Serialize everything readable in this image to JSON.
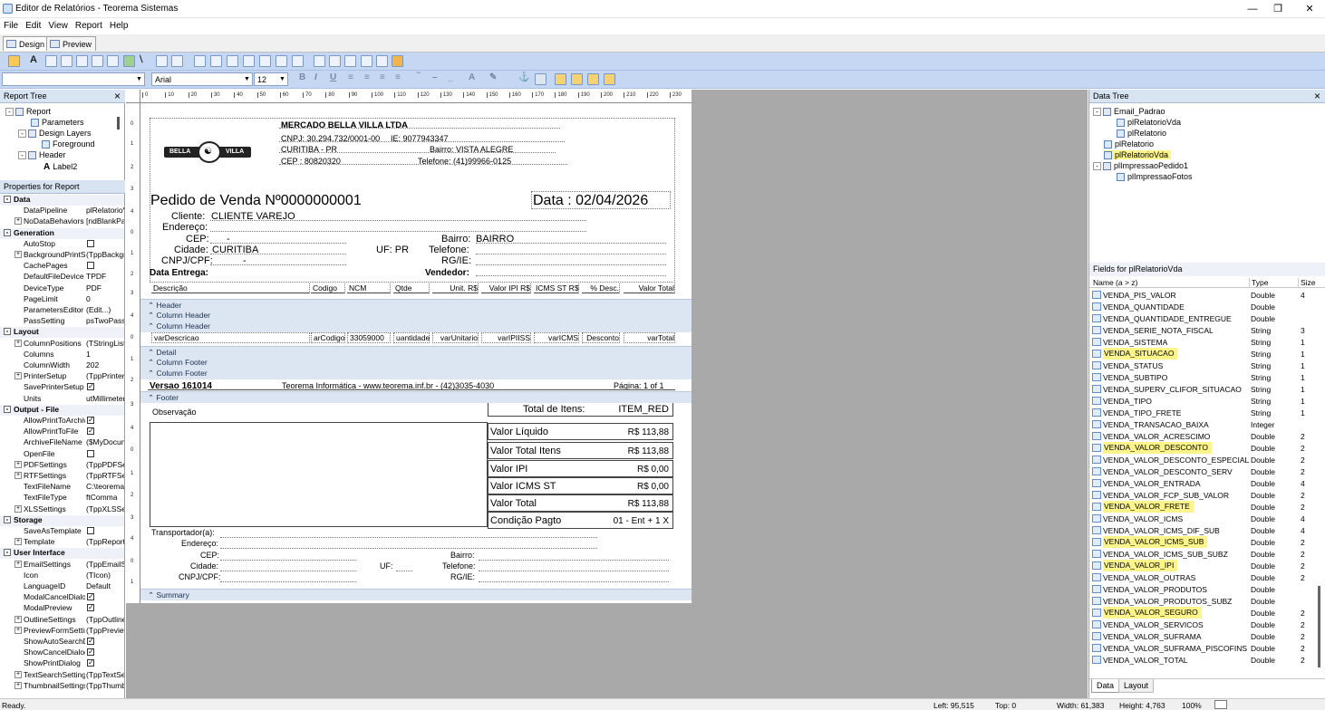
{
  "window": {
    "title": "Editor de Relatórios - Teorema Sistemas"
  },
  "menu": [
    "File",
    "Edit",
    "View",
    "Report",
    "Help"
  ],
  "tabs": {
    "design": "Design",
    "preview": "Preview"
  },
  "format": {
    "font": "Arial",
    "size": "12"
  },
  "report_tree": {
    "title": "Report Tree",
    "items": [
      "Report",
      "Parameters",
      "Design Layers",
      "Foreground",
      "Header",
      "Label2"
    ]
  },
  "properties": {
    "title": "Properties for Report",
    "sections": [
      {
        "name": "Data",
        "rows": [
          [
            "DataPipeline",
            "plRelatorioV"
          ],
          [
            "NoDataBehaviors",
            "[ndBlankPa"
          ]
        ]
      },
      {
        "name": "Generation",
        "rows": [
          [
            "AutoStop",
            ""
          ],
          [
            "BackgroundPrintSe",
            "(TppBackgr"
          ],
          [
            "CachePages",
            ""
          ],
          [
            "DefaultFileDevice",
            "TPDF"
          ],
          [
            "DeviceType",
            "PDF"
          ],
          [
            "PageLimit",
            "0"
          ],
          [
            "ParametersEditor",
            "(Edit...)"
          ],
          [
            "PassSetting",
            "psTwoPass"
          ]
        ]
      },
      {
        "name": "Layout",
        "rows": [
          [
            "ColumnPositions",
            "(TStringList"
          ],
          [
            "Columns",
            "1"
          ],
          [
            "ColumnWidth",
            "202"
          ],
          [
            "PrinterSetup",
            "(TppPrinter"
          ],
          [
            "SavePrinterSetup",
            ""
          ],
          [
            "Units",
            "utMillimeter"
          ]
        ]
      },
      {
        "name": "Output - File",
        "rows": [
          [
            "AllowPrintToArchiv",
            ""
          ],
          [
            "AllowPrintToFile",
            ""
          ],
          [
            "ArchiveFileName",
            "($MyDocum"
          ],
          [
            "OpenFile",
            ""
          ],
          [
            "PDFSettings",
            "(TppPDFSet"
          ],
          [
            "RTFSettings",
            "(TppRTFSet"
          ],
          [
            "TextFileName",
            "C:\\teorema"
          ],
          [
            "TextFileType",
            "ftComma"
          ],
          [
            "XLSSettings",
            "(TppXLSSet"
          ]
        ]
      },
      {
        "name": "Storage",
        "rows": [
          [
            "SaveAsTemplate",
            ""
          ],
          [
            "Template",
            "(TppReport"
          ]
        ]
      },
      {
        "name": "User Interface",
        "rows": [
          [
            "EmailSettings",
            "(TppEmailSe"
          ],
          [
            "Icon",
            "(TIcon)"
          ],
          [
            "LanguageID",
            "Default"
          ],
          [
            "ModalCancelDialog",
            ""
          ],
          [
            "ModalPreview",
            ""
          ],
          [
            "OutlineSettings",
            "(TppOutline"
          ],
          [
            "PreviewFormSettin",
            "(TppPreview"
          ],
          [
            "ShowAutoSearchD",
            ""
          ],
          [
            "ShowCancelDialog",
            ""
          ],
          [
            "ShowPrintDialog",
            ""
          ],
          [
            "TextSearchSetting",
            "(TppTextSe"
          ],
          [
            "ThumbnailSettings",
            "(TppThumb"
          ]
        ]
      }
    ]
  },
  "report": {
    "company": "MERCADO BELLA VILLA LTDA",
    "cnpj": "CNPJ: 30.294.732/0001-00",
    "ie": "IE: 9077943347",
    "city": "CURITIBA - PR",
    "bairro": "Bairro: VISTA ALEGRE",
    "cep": "CEP : 80820320",
    "telefone": "Telefone: (41)99966-0125",
    "logo_left": "BELLA",
    "logo_right": "VILLA",
    "title": "Pedido de Venda Nº0000000001",
    "date": "Data : 02/04/2026",
    "lbl_cliente": "Cliente:",
    "cliente": "CLIENTE VAREJO",
    "lbl_endereco": "Endereço:",
    "lbl_cep": "CEP:",
    "cep_val": "-",
    "lbl_bairro": "Bairro:",
    "bairro_val": "BAIRRO",
    "lbl_cidade": "Cidade:",
    "cidade_val": "CURITIBA",
    "lbl_uf": "UF: PR",
    "lbl_telefone": "Telefone:",
    "lbl_cnpjcpf": "CNPJ/CPF:",
    "cnpjcpf_val": "-",
    "lbl_rgie": "RG/IE:",
    "lbl_data_entrega": "Data Entrega:",
    "lbl_vendedor": "Vendedor:",
    "columns": [
      "Descrição",
      "Codigo",
      "NCM",
      "Qtde",
      "Unit. R$",
      "Valor IPI R$",
      "ICMS ST R$",
      "% Desc.",
      "Valor Total"
    ],
    "detail": [
      "varDescricao",
      "arCodigo",
      "33059000",
      "uantidade",
      "varUnitario",
      "varIPIISS",
      "varICMS",
      "Desconto",
      "varTotal"
    ],
    "bands": {
      "header": "Header",
      "colheader1": "Column Header",
      "colheader2": "Column Header",
      "detail": "Detail",
      "colfooter1": "Column Footer",
      "colfooter2": "Column Footer",
      "footer": "Footer",
      "summary": "Summary"
    },
    "versao": "Versao 161014",
    "teorema": "Teorema Informática  -  www.teorema.inf.br  -  (42)3035-4030",
    "pagina": "Página: 1 of 1",
    "observacao": "Observação",
    "total_itens_lbl": "Total de Itens:",
    "total_itens_val": "ITEM_RED",
    "valor_liquido": "Valor Líquido",
    "valor_liquido_val": "R$ 113,88",
    "valor_total_itens": "Valor Total Itens",
    "valor_total_itens_val": "R$ 113,88",
    "valor_ipi": "Valor IPI",
    "valor_ipi_val": "R$ 0,00",
    "valor_icms_st": "Valor ICMS ST",
    "valor_icms_st_val": "R$ 0,00",
    "valor_total": "Valor Total",
    "valor_total_val": "R$ 113,88",
    "cond_pagto": "Condição Pagto",
    "cond_pagto_val": "01 - Ent + 1 X",
    "transportador": "Transportador(a):",
    "t_endereco": "Endereço:",
    "t_cep": "CEP:",
    "t_bairro": "Bairro:",
    "t_cidade": "Cidade:",
    "t_uf": "UF:",
    "t_telefone": "Telefone:",
    "t_cnpjcpf": "CNPJ/CPF:",
    "t_rgie": "RG/IE:"
  },
  "data_tree": {
    "title": "Data Tree",
    "items": [
      "Email_Padrao",
      "plRelatorioVda",
      "plRelatorio",
      "plRelatorio",
      "plRelatorioVda",
      "plImpressaoPedido1",
      "plImpressaoFotos"
    ]
  },
  "fields": {
    "title": "Fields for plRelatorioVda",
    "headers": [
      "Name (a > z)",
      "Type",
      "Size"
    ],
    "rows": [
      [
        "VENDA_PIS_VALOR",
        "Double",
        "4",
        false
      ],
      [
        "VENDA_QUANTIDADE",
        "Double",
        "",
        false
      ],
      [
        "VENDA_QUANTIDADE_ENTREGUE",
        "Double",
        "",
        false
      ],
      [
        "VENDA_SERIE_NOTA_FISCAL",
        "String",
        "3",
        false
      ],
      [
        "VENDA_SISTEMA",
        "String",
        "1",
        false
      ],
      [
        "VENDA_SITUACAO",
        "String",
        "1",
        true
      ],
      [
        "VENDA_STATUS",
        "String",
        "1",
        false
      ],
      [
        "VENDA_SUBTIPO",
        "String",
        "1",
        false
      ],
      [
        "VENDA_SUPERV_CLIFOR_SITUACAO",
        "String",
        "1",
        false
      ],
      [
        "VENDA_TIPO",
        "String",
        "1",
        false
      ],
      [
        "VENDA_TIPO_FRETE",
        "String",
        "1",
        false
      ],
      [
        "VENDA_TRANSACAO_BAIXA",
        "Integer",
        "",
        false
      ],
      [
        "VENDA_VALOR_ACRESCIMO",
        "Double",
        "2",
        false
      ],
      [
        "VENDA_VALOR_DESCONTO",
        "Double",
        "2",
        true
      ],
      [
        "VENDA_VALOR_DESCONTO_ESPECIAL",
        "Double",
        "2",
        false
      ],
      [
        "VENDA_VALOR_DESCONTO_SERV",
        "Double",
        "2",
        false
      ],
      [
        "VENDA_VALOR_ENTRADA",
        "Double",
        "4",
        false
      ],
      [
        "VENDA_VALOR_FCP_SUB_VALOR",
        "Double",
        "2",
        false
      ],
      [
        "VENDA_VALOR_FRETE",
        "Double",
        "2",
        true
      ],
      [
        "VENDA_VALOR_ICMS",
        "Double",
        "4",
        false
      ],
      [
        "VENDA_VALOR_ICMS_DIF_SUB",
        "Double",
        "4",
        false
      ],
      [
        "VENDA_VALOR_ICMS_SUB",
        "Double",
        "2",
        true
      ],
      [
        "VENDA_VALOR_ICMS_SUB_SUBZ",
        "Double",
        "2",
        false
      ],
      [
        "VENDA_VALOR_IPI",
        "Double",
        "2",
        true
      ],
      [
        "VENDA_VALOR_OUTRAS",
        "Double",
        "2",
        false
      ],
      [
        "VENDA_VALOR_PRODUTOS",
        "Double",
        "",
        false
      ],
      [
        "VENDA_VALOR_PRODUTOS_SUBZ",
        "Double",
        "",
        false
      ],
      [
        "VENDA_VALOR_SEGURO",
        "Double",
        "2",
        true
      ],
      [
        "VENDA_VALOR_SERVICOS",
        "Double",
        "2",
        false
      ],
      [
        "VENDA_VALOR_SUFRAMA",
        "Double",
        "2",
        false
      ],
      [
        "VENDA_VALOR_SUFRAMA_PISCOFINS",
        "Double",
        "2",
        false
      ],
      [
        "VENDA_VALOR_TOTAL",
        "Double",
        "2",
        false
      ]
    ]
  },
  "bottom_tabs": [
    "Data",
    "Layout"
  ],
  "status": {
    "text": "Ready.",
    "left": "Left: 95,515",
    "top": "Top: 0",
    "width": "Width: 61,383",
    "height": "Height: 4,763",
    "zoom": "100%"
  }
}
